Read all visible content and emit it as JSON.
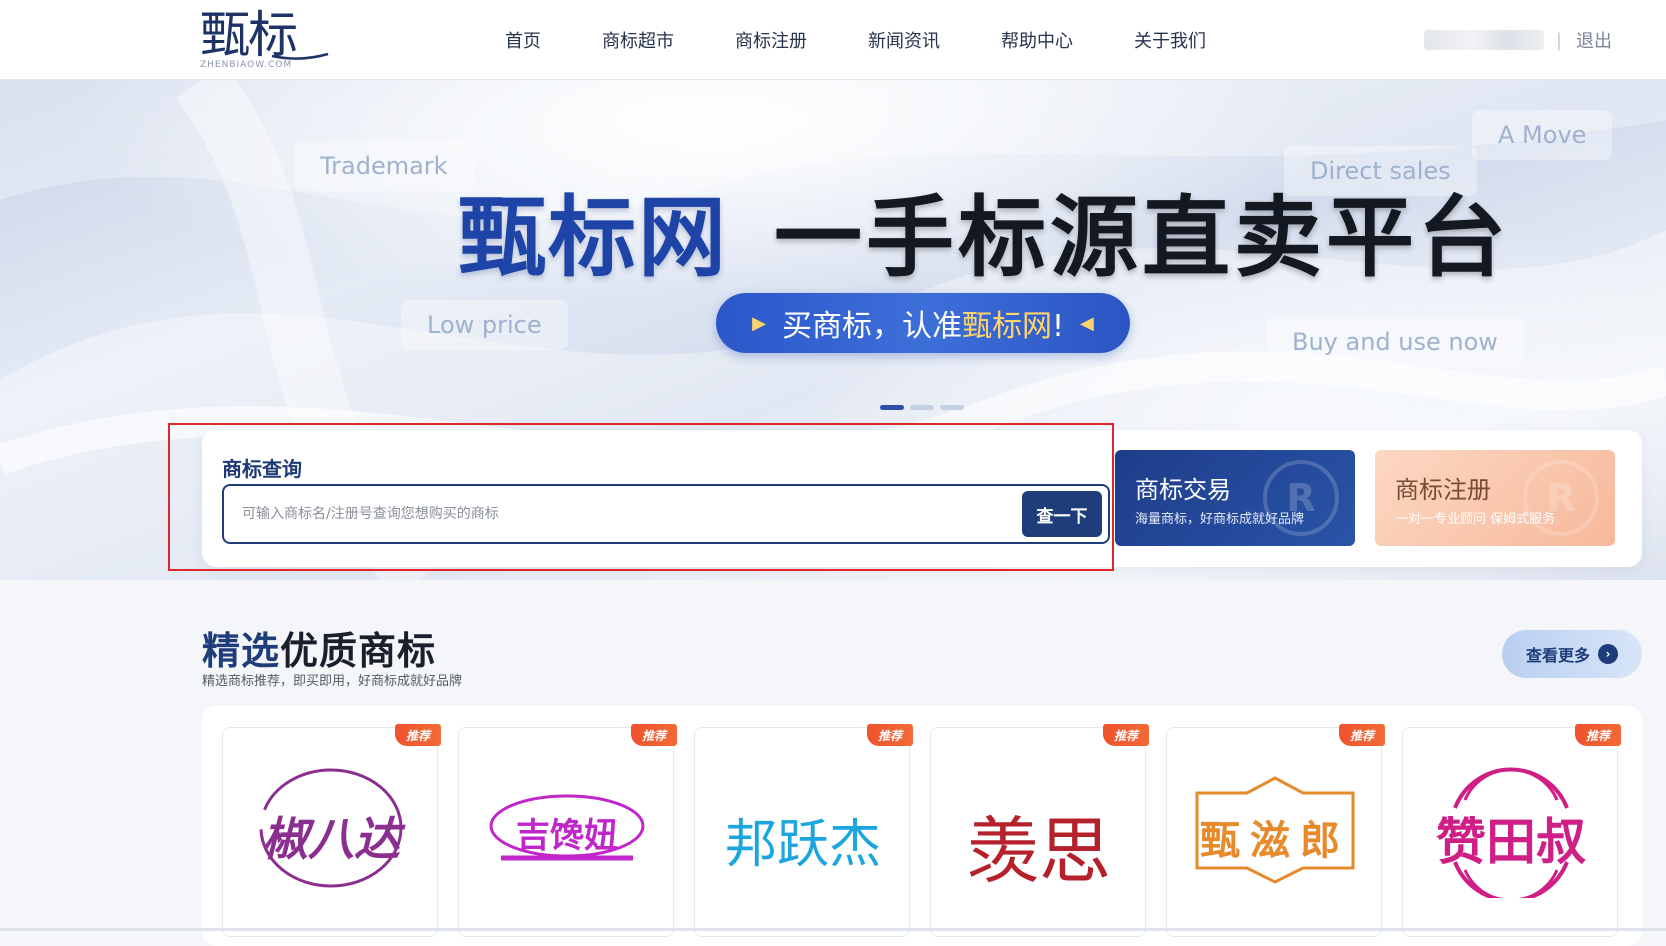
{
  "header": {
    "logo_text": "甄标",
    "logo_sub": "ZHENBIAOW.COM",
    "nav": [
      "首页",
      "商标超市",
      "商标注册",
      "新闻资讯",
      "帮助中心",
      "关于我们"
    ],
    "logout": "退出",
    "separator": "|"
  },
  "banner": {
    "tags": {
      "trademark": "Trademark",
      "a_move": "A Move",
      "direct_sales": "Direct sales",
      "low_price": "Low price",
      "buy_and_use": "Buy and use now"
    },
    "headline_brand": "甄标网",
    "headline_slogan": "一手标源直卖平台",
    "pill_text_prefix": "买商标，认准",
    "pill_text_highlight": "甄标网",
    "pill_text_suffix": "!",
    "slide_count": 3,
    "active_slide": 1
  },
  "search": {
    "title": "商标查询",
    "placeholder": "可输入商标名/注册号查询您想购买的商标",
    "button": "查一下"
  },
  "service_cards": [
    {
      "title": "商标交易",
      "subtitle": "海量商标，好商标成就好品牌",
      "mark": "R"
    },
    {
      "title": "商标注册",
      "subtitle": "一对一专业顾问 保姆式服务",
      "mark": "R"
    }
  ],
  "featured": {
    "title_accent": "精选",
    "title_rest": "优质商标",
    "subtitle": "精选商标推荐，即买即用，好商标成就好品牌",
    "more_button": "查看更多",
    "badge": "推荐",
    "items": [
      {
        "name": "椒八达",
        "color": "#8a2e8f"
      },
      {
        "name": "吉馋妞",
        "color": "#c026c9"
      },
      {
        "name": "邦跃杰",
        "color": "#1ba6e0"
      },
      {
        "name": "羡思",
        "color": "#b5212a"
      },
      {
        "name": "甄滋郎",
        "color": "#e68b2c"
      },
      {
        "name": "赞田叔",
        "color": "#cf1f86"
      }
    ]
  },
  "colors": {
    "brand_navy": "#1e3d7a",
    "headline_blue": "#1e44a8",
    "highlight_red": "#e0262b",
    "badge_orange": "#f0522d"
  }
}
